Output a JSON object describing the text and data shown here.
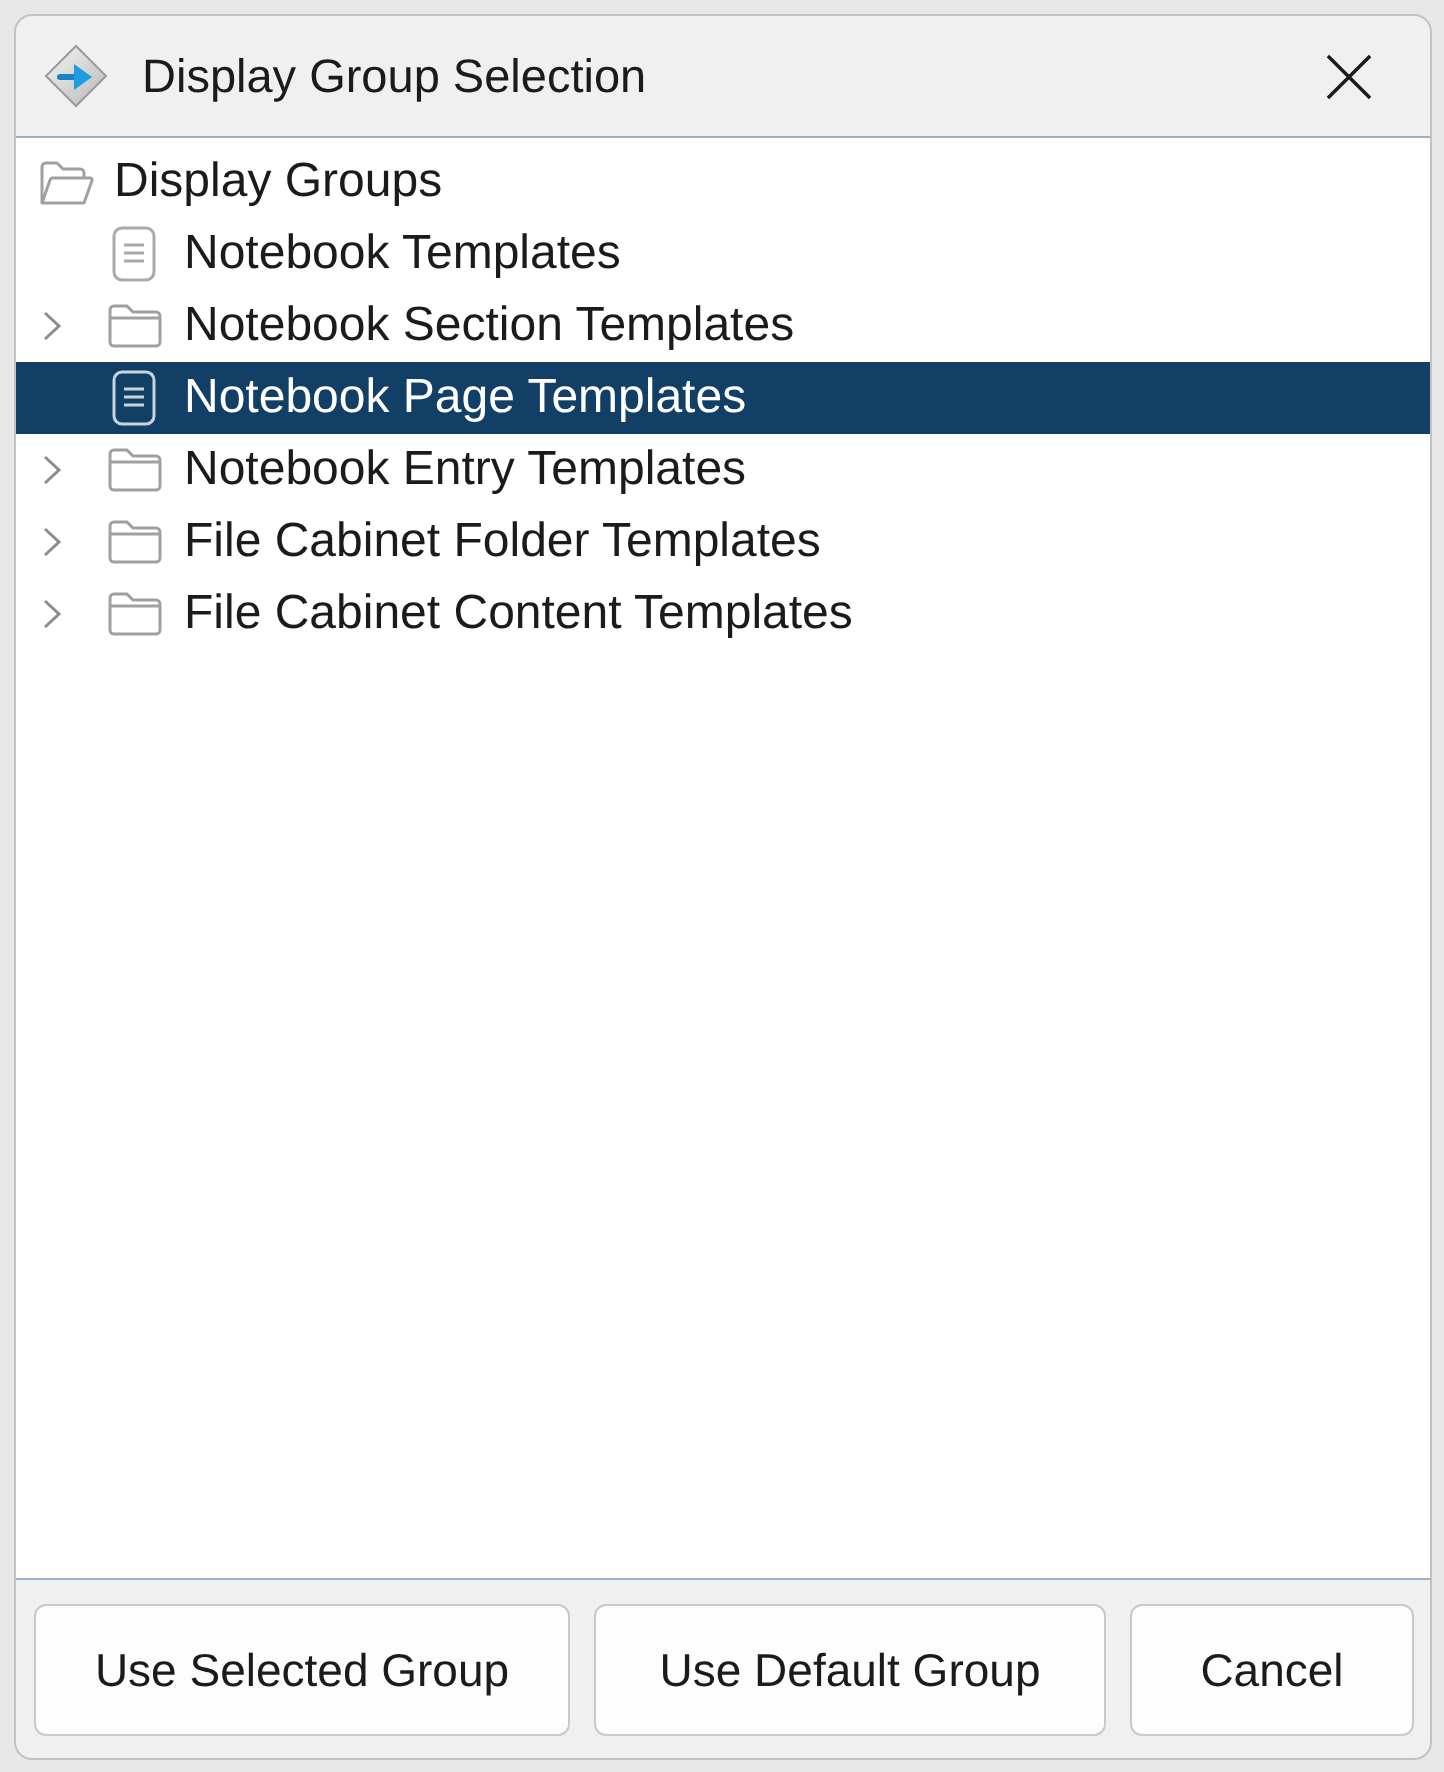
{
  "window": {
    "title": "Display Group Selection"
  },
  "tree": {
    "items": [
      {
        "label": "Display Groups",
        "kind": "folder",
        "expanded": true,
        "selected": false,
        "children": [
          {
            "label": "Notebook Templates",
            "kind": "document",
            "selected": false
          },
          {
            "label": "Notebook Section Templates",
            "kind": "folder",
            "expanded": false,
            "selected": false
          },
          {
            "label": "Notebook Page Templates",
            "kind": "document",
            "selected": true
          },
          {
            "label": "Notebook Entry Templates",
            "kind": "folder",
            "expanded": false,
            "selected": false
          },
          {
            "label": "File Cabinet Folder Templates",
            "kind": "folder",
            "expanded": false,
            "selected": false
          },
          {
            "label": "File Cabinet Content Templates",
            "kind": "folder",
            "expanded": false,
            "selected": false
          }
        ]
      }
    ]
  },
  "buttons": [
    "Use Selected Group",
    "Use Default Group",
    "Cancel"
  ]
}
